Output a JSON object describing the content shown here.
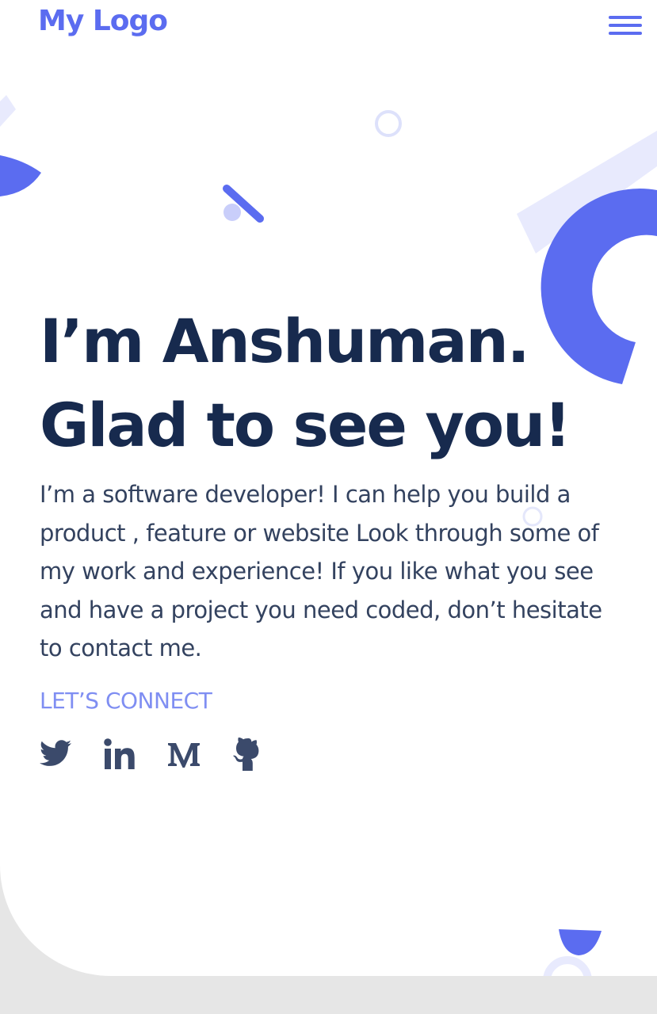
{
  "header": {
    "logo_text": "My Logo",
    "menu_icon": "hamburger-menu-icon"
  },
  "hero": {
    "headline_line1": "I’m Anshuman.",
    "headline_line2": "Glad to see you!",
    "intro": "I’m a software developer! I can help you build a product , feature or website Look through some of my work and experience! If you like what you see and have a project you need coded, don’t hesitate to contact me.",
    "connect_label": "LET’S CONNECT"
  },
  "social_links": [
    {
      "icon": "twitter-icon"
    },
    {
      "icon": "linkedin-icon"
    },
    {
      "icon": "medium-icon"
    },
    {
      "icon": "github-icon"
    }
  ],
  "colors": {
    "accent": "#5b6cf0",
    "accent_light": "#e8eafd",
    "heading": "#172a4e",
    "body_text": "#33425f",
    "connect_label": "#7f8ef2",
    "icon": "#3b4a6b",
    "page_bg": "#e6e6e6",
    "card_bg": "#ffffff"
  }
}
